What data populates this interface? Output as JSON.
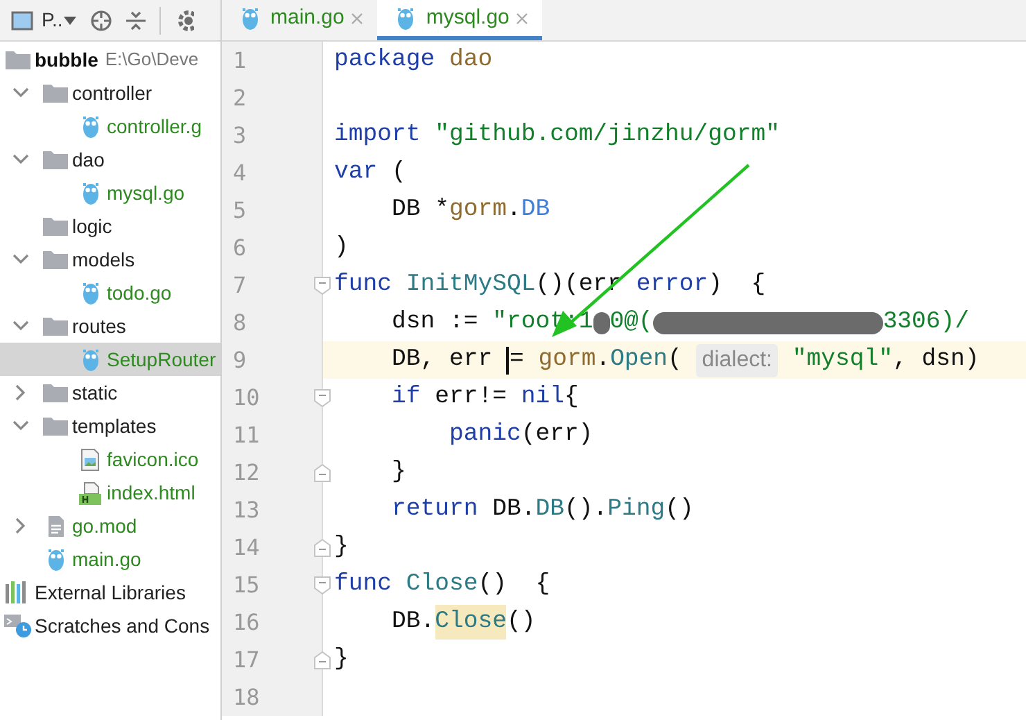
{
  "sidebar": {
    "view_label": "P..",
    "tree": [
      {
        "name": "bubble",
        "hint": "E:\\Go\\Deve",
        "kind": "root",
        "selected": false,
        "children": [
          {
            "name": "controller",
            "kind": "folder",
            "expanded": true,
            "selected": false,
            "added": false,
            "children": [
              {
                "name": "controller.g",
                "kind": "go",
                "selected": false,
                "added": true
              }
            ]
          },
          {
            "name": "dao",
            "kind": "folder",
            "expanded": true,
            "selected": false,
            "added": false,
            "children": [
              {
                "name": "mysql.go",
                "kind": "go",
                "selected": false,
                "added": true
              }
            ]
          },
          {
            "name": "logic",
            "kind": "folder",
            "selected": false,
            "added": false
          },
          {
            "name": "models",
            "kind": "folder",
            "expanded": true,
            "selected": false,
            "added": false,
            "children": [
              {
                "name": "todo.go",
                "kind": "go",
                "selected": false,
                "added": true
              }
            ]
          },
          {
            "name": "routes",
            "kind": "folder",
            "expanded": true,
            "selected": false,
            "added": false,
            "children": [
              {
                "name": "SetupRouter",
                "kind": "go",
                "selected": true,
                "added": true
              }
            ]
          },
          {
            "name": "static",
            "kind": "folder",
            "expanded": false,
            "selected": false,
            "added": false
          },
          {
            "name": "templates",
            "kind": "folder",
            "expanded": true,
            "selected": false,
            "added": false,
            "children": [
              {
                "name": "favicon.ico",
                "kind": "image",
                "selected": false,
                "added": true
              },
              {
                "name": "index.html",
                "kind": "html",
                "selected": false,
                "added": true
              }
            ]
          },
          {
            "name": "go.mod",
            "kind": "mod",
            "expanded": false,
            "selected": false,
            "added": true
          },
          {
            "name": "main.go",
            "kind": "go",
            "selected": false,
            "added": true
          }
        ]
      },
      {
        "name": "External Libraries",
        "kind": "libraries",
        "selected": false,
        "added": false
      },
      {
        "name": "Scratches and Cons",
        "kind": "scratches",
        "selected": false,
        "added": false
      }
    ]
  },
  "tabs": [
    {
      "label": "main.go",
      "selected": false
    },
    {
      "label": "mysql.go",
      "selected": true
    }
  ],
  "editor": {
    "lines": [
      {
        "number": "1",
        "kind": "line",
        "current": false,
        "tokens": [
          {
            "kind": "keyword",
            "text": "package"
          },
          {
            "kind": "package",
            "text": " dao"
          }
        ]
      },
      {
        "number": "2",
        "kind": "line",
        "current": false
      },
      {
        "number": "3",
        "kind": "line",
        "current": false,
        "tokens": [
          {
            "kind": "keyword",
            "text": "import"
          },
          {
            "kind": "string",
            "text": " \"github.com/jinzhu/gorm\""
          }
        ]
      },
      {
        "number": "4",
        "kind": "line",
        "current": false,
        "tokens": [
          {
            "kind": "keyword",
            "text": "var"
          },
          {
            "kind": "plain",
            "text": " ("
          }
        ]
      },
      {
        "number": "5",
        "kind": "line",
        "current": false,
        "tokens": [
          {
            "kind": "plain",
            "text": "    DB *"
          },
          {
            "kind": "package",
            "text": "gorm"
          },
          {
            "kind": "plain",
            "text": "."
          },
          {
            "kind": "type",
            "text": "DB"
          }
        ]
      },
      {
        "number": "6",
        "kind": "line",
        "current": false,
        "tokens": [
          {
            "kind": "plain",
            "text": ")"
          }
        ]
      },
      {
        "number": "7",
        "kind": "fold_start",
        "current": false,
        "tokens": [
          {
            "kind": "keyword",
            "text": "func"
          },
          {
            "kind": "function",
            "text": " InitMySQL"
          },
          {
            "kind": "plain",
            "text": "()(err "
          },
          {
            "kind": "keyword",
            "text": "error"
          },
          {
            "kind": "plain",
            "text": ")  {"
          }
        ]
      },
      {
        "number": "8",
        "kind": "line",
        "current": false,
        "tokens": [
          {
            "kind": "plain",
            "text": "    dsn := "
          },
          {
            "kind": "string",
            "text": "\"root:1"
          },
          {
            "kind": "redacted_short"
          },
          {
            "kind": "string",
            "text": "0@("
          },
          {
            "kind": "redacted_long"
          },
          {
            "kind": "string",
            "text": "3306)/"
          }
        ]
      },
      {
        "number": "9",
        "kind": "line",
        "current": true,
        "tokens": [
          {
            "kind": "plain",
            "text": "    DB, err "
          },
          {
            "kind": "caret"
          },
          {
            "kind": "plain",
            "text": "= "
          },
          {
            "kind": "package",
            "text": "gorm"
          },
          {
            "kind": "plain",
            "text": "."
          },
          {
            "kind": "function",
            "text": "Open"
          },
          {
            "kind": "plain",
            "text": "( "
          },
          {
            "kind": "hint",
            "text": "dialect:"
          },
          {
            "kind": "string",
            "text": " \"mysql\""
          },
          {
            "kind": "plain",
            "text": ", dsn)"
          }
        ]
      },
      {
        "number": "10",
        "kind": "fold_start",
        "current": false,
        "tokens": [
          {
            "kind": "keyword",
            "text": "    if"
          },
          {
            "kind": "plain",
            "text": " err!= "
          },
          {
            "kind": "keyword",
            "text": "nil"
          },
          {
            "kind": "plain",
            "text": "{"
          }
        ]
      },
      {
        "number": "11",
        "kind": "line",
        "current": false,
        "tokens": [
          {
            "kind": "keyword",
            "text": "        panic"
          },
          {
            "kind": "plain",
            "text": "(err)"
          }
        ]
      },
      {
        "number": "12",
        "kind": "fold_end",
        "current": false,
        "tokens": [
          {
            "kind": "plain",
            "text": "    }"
          }
        ]
      },
      {
        "number": "13",
        "kind": "line",
        "current": false,
        "tokens": [
          {
            "kind": "keyword",
            "text": "    return"
          },
          {
            "kind": "plain",
            "text": " DB."
          },
          {
            "kind": "function",
            "text": "DB"
          },
          {
            "kind": "plain",
            "text": "()."
          },
          {
            "kind": "function",
            "text": "Ping"
          },
          {
            "kind": "plain",
            "text": "()"
          }
        ]
      },
      {
        "number": "14",
        "kind": "fold_end",
        "current": false,
        "tokens": [
          {
            "kind": "plain",
            "text": "}"
          }
        ]
      },
      {
        "number": "15",
        "kind": "fold_start",
        "current": false,
        "tokens": [
          {
            "kind": "keyword",
            "text": "func"
          },
          {
            "kind": "function",
            "text": " Close"
          },
          {
            "kind": "plain",
            "text": "()  {"
          }
        ]
      },
      {
        "number": "16",
        "kind": "line",
        "current": false,
        "tokens": [
          {
            "kind": "plain",
            "text": "    DB."
          },
          {
            "kind": "function",
            "text": "Close",
            "highlighted": true
          },
          {
            "kind": "plain",
            "text": "()"
          }
        ]
      },
      {
        "number": "17",
        "kind": "fold_end",
        "current": false,
        "tokens": [
          {
            "kind": "plain",
            "text": "}"
          }
        ]
      },
      {
        "number": "18",
        "kind": "line",
        "current": false
      }
    ]
  }
}
